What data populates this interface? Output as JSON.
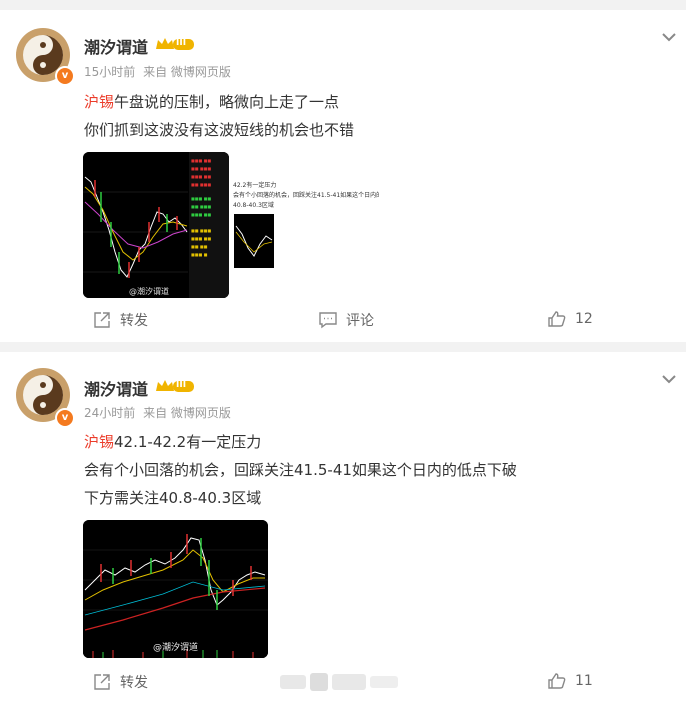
{
  "posts": [
    {
      "author": "潮汐谓道",
      "level_badge": "III",
      "time": "15小时前",
      "source": "来自 微博网页版",
      "topic": "沪锡",
      "line1_rest": "午盘说的压制，略微向上走了一点",
      "line2": "你们抓到这波没有这波短线的机会也不错",
      "repost_label": "转发",
      "comment_label": "评论",
      "like_count": "12",
      "image_watermark": "@潮汐谓道",
      "embedded_screenshot": {
        "line_a": "42.2有一定压力",
        "line_b": "会有个小回落的机会，回踩关注41.5-41如果这个日内的低点下破",
        "line_c": "40.8-40.3区域"
      }
    },
    {
      "author": "潮汐谓道",
      "level_badge": "III",
      "time": "24小时前",
      "source": "来自 微博网页版",
      "topic": "沪锡",
      "line1_rest": "42.1-42.2有一定压力",
      "line2": "会有个小回落的机会，回踩关注41.5-41如果这个日内的低点下破",
      "line3": "下方需关注40.8-40.3区域",
      "repost_label": "转发",
      "like_count": "11",
      "image_watermark": "@潮汐谓道"
    }
  ],
  "colors": {
    "topic": "#eb3c2a",
    "vip_badge": "#f47a1f",
    "meta_text": "#999999",
    "chart_red": "#e03030",
    "chart_green": "#2ecc40"
  }
}
